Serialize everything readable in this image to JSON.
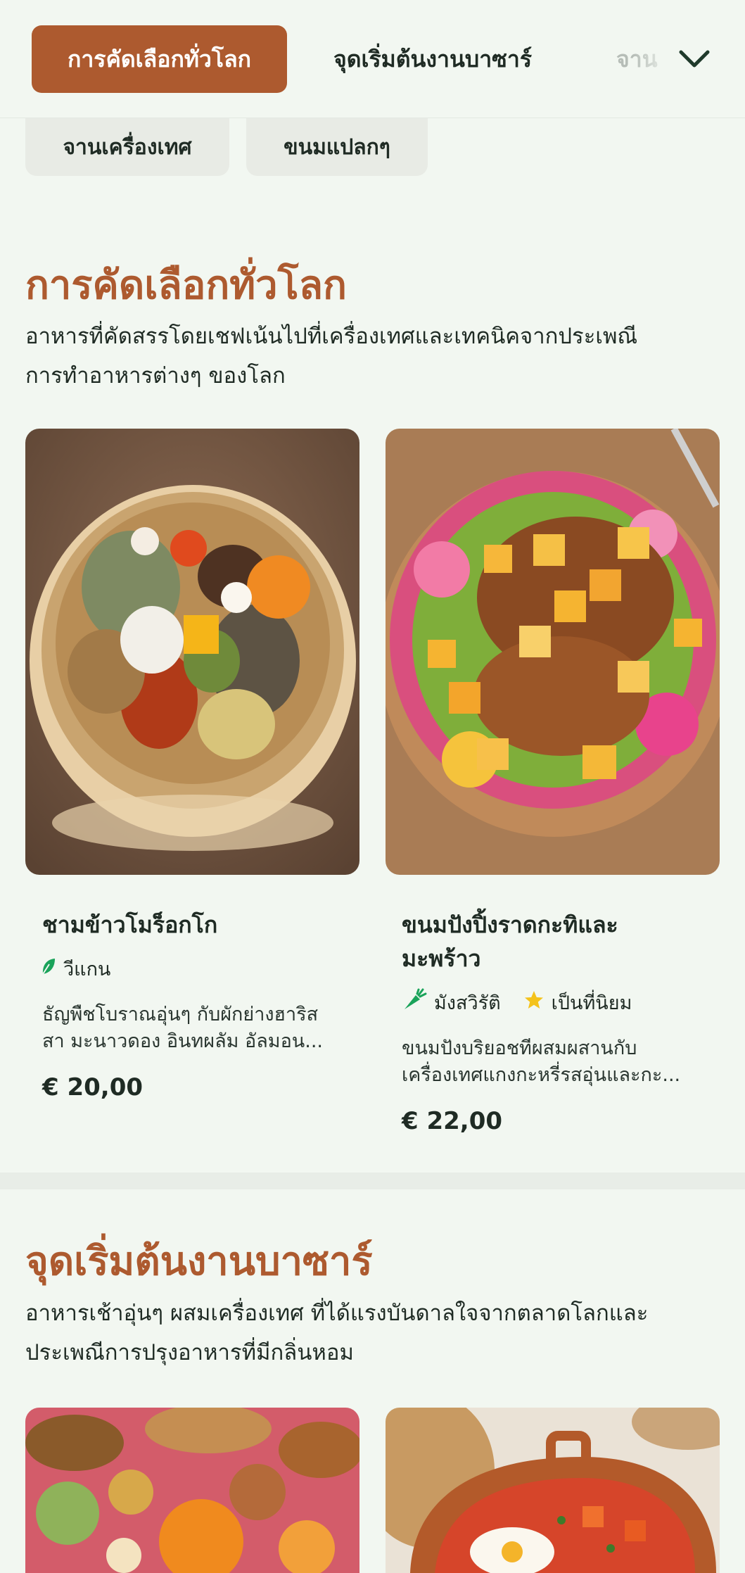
{
  "tabs": {
    "active": "การคัดเลือกทั่วโลก",
    "second": "จุดเริ่มต้นงานบาซาร์",
    "third": "จาน"
  },
  "chips": [
    "จานเครื่องเทศ",
    "ขนมแปลกๆ"
  ],
  "section1": {
    "title": "การคัดเลือกทั่วโลก",
    "desc_line1": "อาหารที่คัดสรรโดยเชฟเน้นไปที่เครื่องเทศและเทคนิคจากประเพณี",
    "desc_line2": "การทำอาหารต่างๆ ของโลก",
    "cards": [
      {
        "title": "ชามข้าวโมร็อกโก",
        "tag": "วีแกน",
        "desc_line1": "ธัญพืชโบราณอุ่นๆ กับผักย่างฮาริส",
        "desc_line2": "สา มะนาวดอง อินทผลัม อัลมอน...",
        "price": "€ 20,00"
      },
      {
        "title_line1": "ขนมปังปิ้งราดกะทิและ",
        "title_line2": "มะพร้าว",
        "tag1": "มังสวิรัติ",
        "tag2": "เป็นที่นิยม",
        "desc_line1": "ขนมปังบริยอชทีผสมผสานกับ",
        "desc_line2": "เครื่องเทศแกงกะหรี่รสอุ่นและกะ...",
        "price": "€ 22,00"
      }
    ]
  },
  "section2": {
    "title": "จุดเริ่มต้นงานบาซาร์",
    "desc_line1": "อาหารเช้าอุ่นๆ ผสมเครื่องเทศ ที่ได้แรงบันดาลใจจากตลาดโลกและ",
    "desc_line2": "ประเพณีการปรุงอาหารที่มีกลิ่นหอม"
  },
  "icons": {
    "tabs_more": "chevron-down-icon",
    "vegan": "leaf-icon",
    "vegetarian": "carrot-icon",
    "popular": "star-icon"
  },
  "colors": {
    "accent": "#ad5a2f",
    "background": "#f2f7f1",
    "vegan_green": "#1aa35a",
    "star": "#f4c21b"
  }
}
